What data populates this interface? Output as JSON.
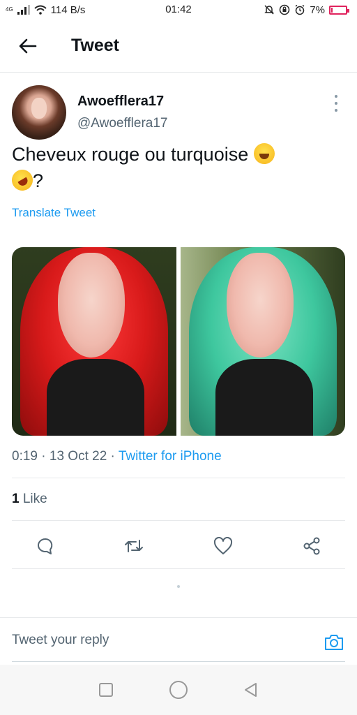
{
  "status_bar": {
    "network": "4G",
    "speed": "114 B/s",
    "time": "01:42",
    "battery": "7%",
    "battery_color": "#e0245e"
  },
  "header": {
    "back_icon": "arrow-left-icon",
    "title": "Tweet"
  },
  "tweet": {
    "author_name": "Awoefflera17",
    "author_handle": "@Awoefflera17",
    "text_part1": "Cheveux rouge ou turquoise ",
    "text_part2": "?",
    "translate_label": "Translate Tweet",
    "media": [
      {
        "description": "red-hair-photo",
        "hair_color": "#d81a1a"
      },
      {
        "description": "turquoise-hair-photo",
        "hair_color": "#3ec79e"
      }
    ],
    "meta": {
      "time": "0:19",
      "separator": "·",
      "date": "13 Oct 22",
      "source": "Twitter for iPhone"
    },
    "likes": {
      "count": "1",
      "label": "Like"
    },
    "actions": [
      "reply-icon",
      "retweet-icon",
      "like-icon",
      "share-icon"
    ]
  },
  "reply": {
    "placeholder": "Tweet your reply",
    "camera_icon": "camera-icon"
  },
  "colors": {
    "accent": "#1d9bf0",
    "text_primary": "#0f1419",
    "text_secondary": "#536471"
  },
  "nav": [
    "recents-square-icon",
    "home-circle-icon",
    "back-triangle-icon"
  ]
}
